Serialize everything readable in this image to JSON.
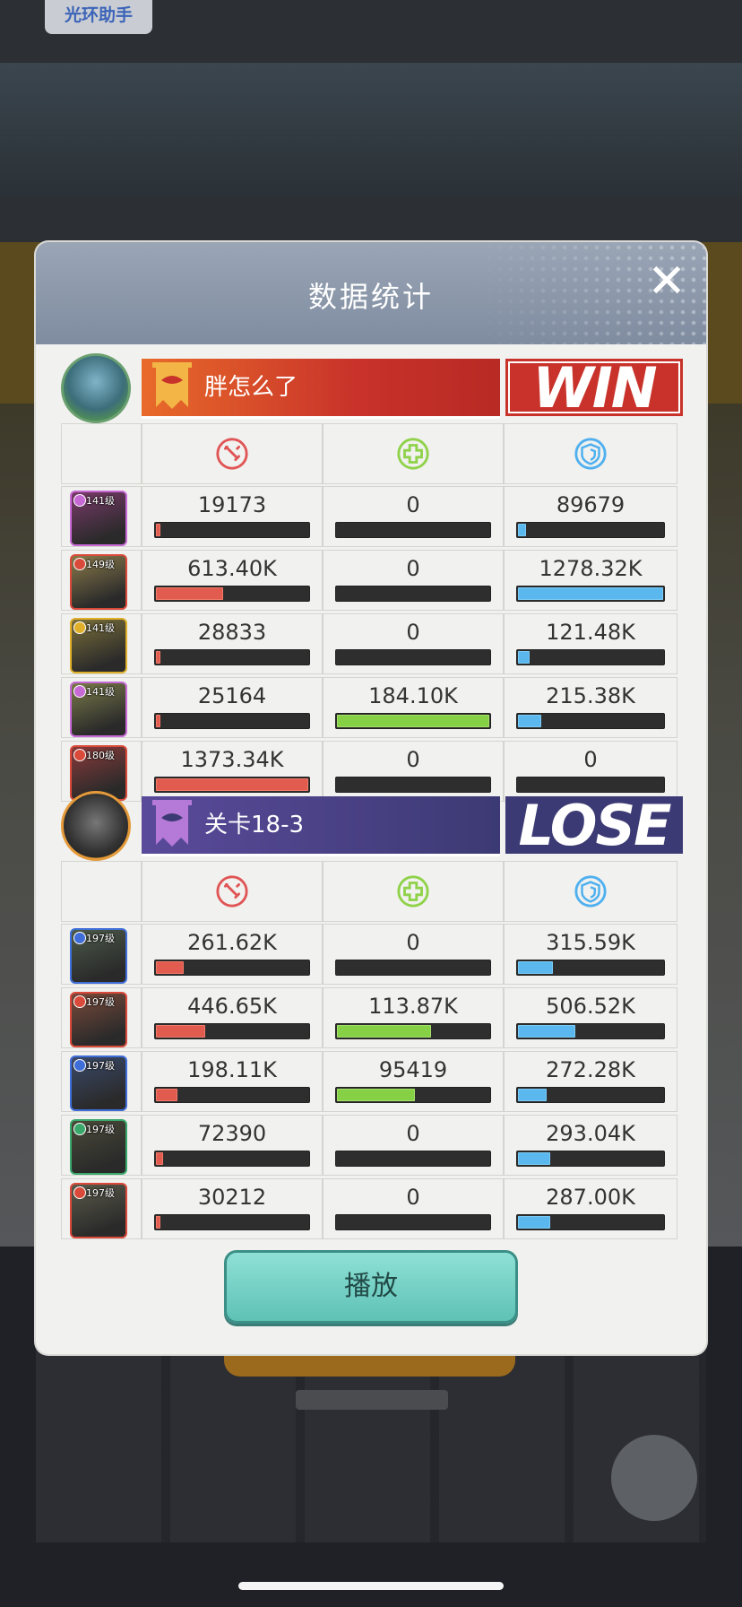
{
  "helper_tab": "光环助手",
  "dialog": {
    "title": "数据统计",
    "play_label": "播放"
  },
  "teams": [
    {
      "name": "胖怎么了",
      "result": "WIN",
      "color": "#c8322a",
      "heroes": [
        {
          "level": "141级",
          "gem_color": "#c86ad6",
          "dmg": "19173",
          "heal": "0",
          "def": "89679",
          "dmg_pct": 2,
          "heal_pct": 0,
          "def_pct": 7
        },
        {
          "level": "149级",
          "gem_color": "#d94a3a",
          "dmg": "613.40K",
          "heal": "0",
          "def": "1278.32K",
          "dmg_pct": 45,
          "heal_pct": 0,
          "def_pct": 100
        },
        {
          "level": "141级",
          "gem_color": "#e0b02a",
          "dmg": "28833",
          "heal": "0",
          "def": "121.48K",
          "dmg_pct": 2,
          "heal_pct": 0,
          "def_pct": 9
        },
        {
          "level": "141级",
          "gem_color": "#c86ad6",
          "dmg": "25164",
          "heal": "184.10K",
          "def": "215.38K",
          "dmg_pct": 2,
          "heal_pct": 100,
          "def_pct": 17
        },
        {
          "level": "180级",
          "gem_color": "#d94a3a",
          "dmg": "1373.34K",
          "heal": "0",
          "def": "0",
          "dmg_pct": 100,
          "heal_pct": 0,
          "def_pct": 0
        }
      ]
    },
    {
      "name": "关卡18-3",
      "result": "LOSE",
      "color": "#3c3a74",
      "heroes": [
        {
          "level": "197级",
          "gem_color": "#3f6ed8",
          "dmg": "261.62K",
          "heal": "0",
          "def": "315.59K",
          "dmg_pct": 19,
          "heal_pct": 0,
          "def_pct": 25
        },
        {
          "level": "197级",
          "gem_color": "#d94a3a",
          "dmg": "446.65K",
          "heal": "113.87K",
          "def": "506.52K",
          "dmg_pct": 33,
          "heal_pct": 62,
          "def_pct": 40
        },
        {
          "level": "197级",
          "gem_color": "#3f6ed8",
          "dmg": "198.11K",
          "heal": "95419",
          "def": "272.28K",
          "dmg_pct": 15,
          "heal_pct": 52,
          "def_pct": 21
        },
        {
          "level": "197级",
          "gem_color": "#3aa86a",
          "dmg": "72390",
          "heal": "0",
          "def": "293.04K",
          "dmg_pct": 6,
          "heal_pct": 0,
          "def_pct": 23
        },
        {
          "level": "197级",
          "gem_color": "#d94a3a",
          "dmg": "30212",
          "heal": "0",
          "def": "287.00K",
          "dmg_pct": 2,
          "heal_pct": 0,
          "def_pct": 23
        }
      ]
    }
  ],
  "stat_icons": [
    "sword-icon",
    "heal-icon",
    "shield-icon"
  ]
}
